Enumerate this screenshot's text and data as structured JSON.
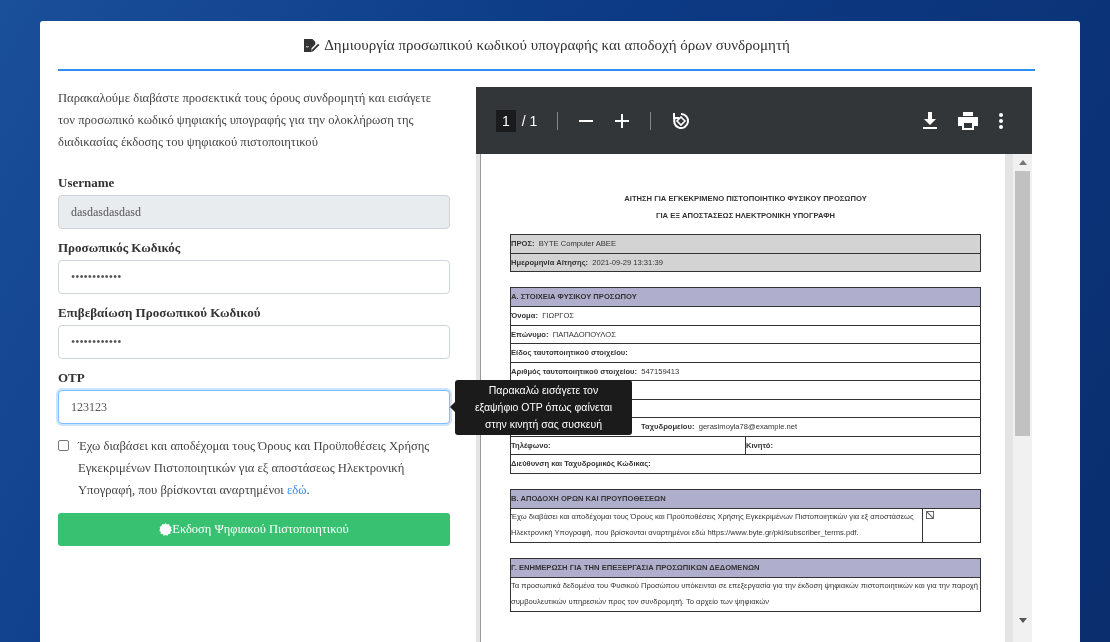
{
  "header": {
    "title": "Δημιουργία προσωπικού κωδικού υπογραφής και αποδοχή όρων συνδρομητή"
  },
  "intro": "Παρακαλούμε διαβάστε προσεκτικά τους όρους συνδρομητή και εισάγετε τον προσωπικό κωδικό ψηφιακής υπογραφής για την ολοκλήρωση της διαδικασίας έκδοσης του ψηφιακού πιστοποιητικού",
  "fields": [
    {
      "label": "Username",
      "value": "dasdasdasdasd",
      "disabled": true,
      "focused": false
    },
    {
      "label": "Προσωπικός Κωδικός",
      "value": "••••••••••••",
      "disabled": false,
      "focused": false
    },
    {
      "label": "Επιβεβαίωση Προσωπικού Κωδικού",
      "value": "••••••••••••",
      "disabled": false,
      "focused": false
    },
    {
      "label": "OTP",
      "value": "123123",
      "disabled": false,
      "focused": true
    }
  ],
  "tooltip": {
    "lines": [
      "Παρακαλώ εισάγετε τον",
      "εξαψήφιο OTP όπως φαίνεται",
      "στην κινητή σας συσκευή"
    ]
  },
  "terms": {
    "checked": false,
    "text": "Έχω διαβάσει και αποδέχομαι τους Όρους και Προϋποθέσεις Χρήσης Εγκεκριμένων Πιστοποιητικών για εξ αποστάσεως Ηλεκτρονική Υπογραφή, που βρίσκονται αναρτημένοι ",
    "link": "εδώ",
    "end": "."
  },
  "submit_button": {
    "label": "Εκδοση Ψηφιακού Πιστοποιητικού"
  },
  "pdf_viewer": {
    "page_input": "1",
    "page_total": "/ 1",
    "title_lines": [
      "ΑΙΤΗΣΗ ΓΙΑ ΕΓΚΕΚΡΙΜΕΝΟ ΠΙΣΤΟΠΟΙΗΤΙΚΟ ΦΥΣΙΚΟΥ ΠΡΟΣΩΠΟΥ",
      "ΓΙΑ ΕΞ ΑΠΟΣΤΑΣΕΩΣ ΗΛΕΚΤΡΟΝΙΚΗ ΥΠΟΓΡΑΦΗ"
    ],
    "sections": [
      {
        "kind": "shaded",
        "rows": [
          {
            "kind": "cells",
            "cells": [
              {
                "label": "ΠΡΟΣ:",
                "value": "BYTE Computer ABEE"
              }
            ]
          },
          {
            "kind": "cells",
            "cells": [
              {
                "label": "Ημερομηνία Αίτησης:",
                "value": "2021-09-29 13:31:39"
              }
            ]
          }
        ]
      },
      {
        "kind": "fields",
        "heading": "Α. ΣΤΟΙΧΕΙΑ ΦΥΣΙΚΟΥ ΠΡΟΣΩΠΟΥ",
        "rows": [
          {
            "kind": "cells",
            "cells": [
              {
                "label": "Όνομα:",
                "value": "ΓΙΩΡΓΟΣ"
              }
            ]
          },
          {
            "kind": "cells",
            "cells": [
              {
                "label": "Επώνυμο:",
                "value": "ΠΑΠΑΔΟΠΟΥΛΟΣ"
              }
            ]
          },
          {
            "kind": "cells",
            "cells": [
              {
                "label": "Είδος ταυτοποιητικού στοιχείου:"
              }
            ]
          },
          {
            "kind": "cells",
            "cells": [
              {
                "label": "Αριθμός ταυτοποιητικού στοιχείου:",
                "value": "547159413"
              }
            ]
          },
          {
            "kind": "covered"
          },
          {
            "kind": "covered"
          },
          {
            "kind": "partly-covered",
            "cells": [
              {
                "label": "Ταχυδρομείου:",
                "value": "gerasimoyla78@example.net"
              }
            ]
          },
          {
            "kind": "cells",
            "cells": [
              {
                "label": "Τηλέφωνο:"
              },
              {
                "label": "Κινητό:"
              }
            ]
          },
          {
            "kind": "cells",
            "cells": [
              {
                "label": "Διεύθυνση και Ταχυδρομικός Κώδικας:"
              }
            ]
          }
        ]
      },
      {
        "kind": "terms",
        "heading": "Β. ΑΠΟΔΟΧΗ ΟΡΩΝ ΚΑΙ ΠΡΟΥΠΟΘΕΣΕΩΝ",
        "text": "Έχω διαβάσει και αποδέχομαι τους Όρους και Προϋποθέσεις Χρήσης Εγκεκριμένων Πιστοποιητικών για εξ αποστάσεως Ηλεκτρονική Υπογραφή, που βρίσκονται αναρτημένοι εδώ https://www.byte.gr/pki/subscriber_terms.pdf.",
        "checked": true
      },
      {
        "kind": "text",
        "heading": "Γ. ΕΝΗΜΕΡΩΣΗ ΓΙΑ ΤΗΝ ΕΠΕΞΕΡΓΑΣΙΑ ΠΡΟΣΩΠΙΚΩΝ ΔΕΔΟΜΕΝΩΝ",
        "text": "Τα προσωπικά δεδομένα του Φυσικού Προσώπου υπόκεινται σε επεξεργασία για την έκδοση ψηφιακών πιστοποιητικών και για την παροχή συμβουλευτικών υπηρεσιών προς τον συνδρομητή. Το αρχείο των ψηφιακών"
      }
    ]
  }
}
